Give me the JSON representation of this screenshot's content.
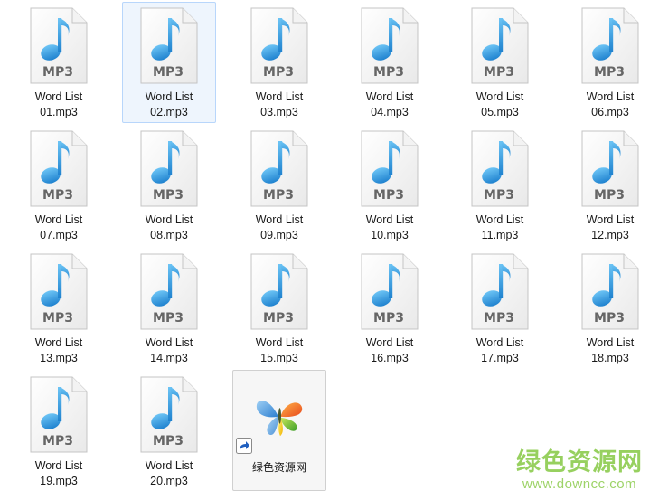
{
  "files": [
    {
      "line1": "Word List",
      "line2": "01.mp3",
      "selected": false
    },
    {
      "line1": "Word List",
      "line2": "02.mp3",
      "selected": true
    },
    {
      "line1": "Word List",
      "line2": "03.mp3",
      "selected": false
    },
    {
      "line1": "Word List",
      "line2": "04.mp3",
      "selected": false
    },
    {
      "line1": "Word List",
      "line2": "05.mp3",
      "selected": false
    },
    {
      "line1": "Word List",
      "line2": "06.mp3",
      "selected": false
    },
    {
      "line1": "Word List",
      "line2": "07.mp3",
      "selected": false
    },
    {
      "line1": "Word List",
      "line2": "08.mp3",
      "selected": false
    },
    {
      "line1": "Word List",
      "line2": "09.mp3",
      "selected": false
    },
    {
      "line1": "Word List",
      "line2": "10.mp3",
      "selected": false
    },
    {
      "line1": "Word List",
      "line2": "11.mp3",
      "selected": false
    },
    {
      "line1": "Word List",
      "line2": "12.mp3",
      "selected": false
    },
    {
      "line1": "Word List",
      "line2": "13.mp3",
      "selected": false
    },
    {
      "line1": "Word List",
      "line2": "14.mp3",
      "selected": false
    },
    {
      "line1": "Word List",
      "line2": "15.mp3",
      "selected": false
    },
    {
      "line1": "Word List",
      "line2": "16.mp3",
      "selected": false
    },
    {
      "line1": "Word List",
      "line2": "17.mp3",
      "selected": false
    },
    {
      "line1": "Word List",
      "line2": "18.mp3",
      "selected": false
    },
    {
      "line1": "Word List",
      "line2": "19.mp3",
      "selected": false
    },
    {
      "line1": "Word List",
      "line2": "20.mp3",
      "selected": false
    }
  ],
  "file_icon": {
    "name": "mp3-file-icon",
    "badge": "MP3",
    "note_color": "#3aa0e0",
    "badge_color": "#666666"
  },
  "shortcut": {
    "label": "绿色资源网",
    "icon": "butterfly-app-icon",
    "overlay_icon": "shortcut-arrow-icon"
  },
  "watermark": {
    "title": "绿色资源网",
    "url": "www.downcc.com",
    "color": "#8ccc4e"
  }
}
